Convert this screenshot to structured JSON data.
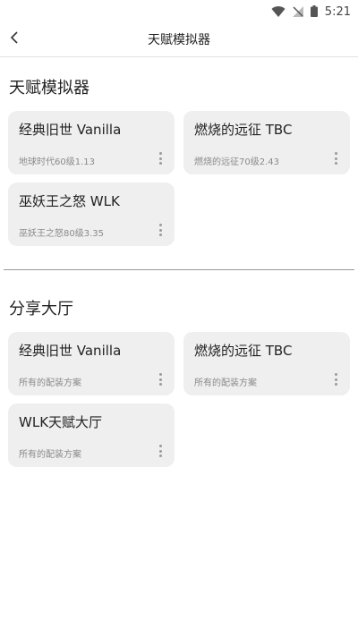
{
  "status_bar": {
    "time": "5:21"
  },
  "app_bar": {
    "title": "天赋模拟器"
  },
  "simulator_section": {
    "title": "天赋模拟器",
    "cards": [
      {
        "title": "经典旧世 Vanilla",
        "subtitle": "地球时代60级1.13"
      },
      {
        "title": "燃烧的远征 TBC",
        "subtitle": "燃烧的远征70级2.43"
      },
      {
        "title": "巫妖王之怒 WLK",
        "subtitle": "巫妖王之怒80级3.35"
      }
    ]
  },
  "share_section": {
    "title": "分享大厅",
    "cards": [
      {
        "title": "经典旧世 Vanilla",
        "subtitle": "所有的配装方案"
      },
      {
        "title": "燃烧的远征 TBC",
        "subtitle": "所有的配装方案"
      },
      {
        "title": "WLK天赋大厅",
        "subtitle": "所有的配装方案"
      }
    ]
  }
}
